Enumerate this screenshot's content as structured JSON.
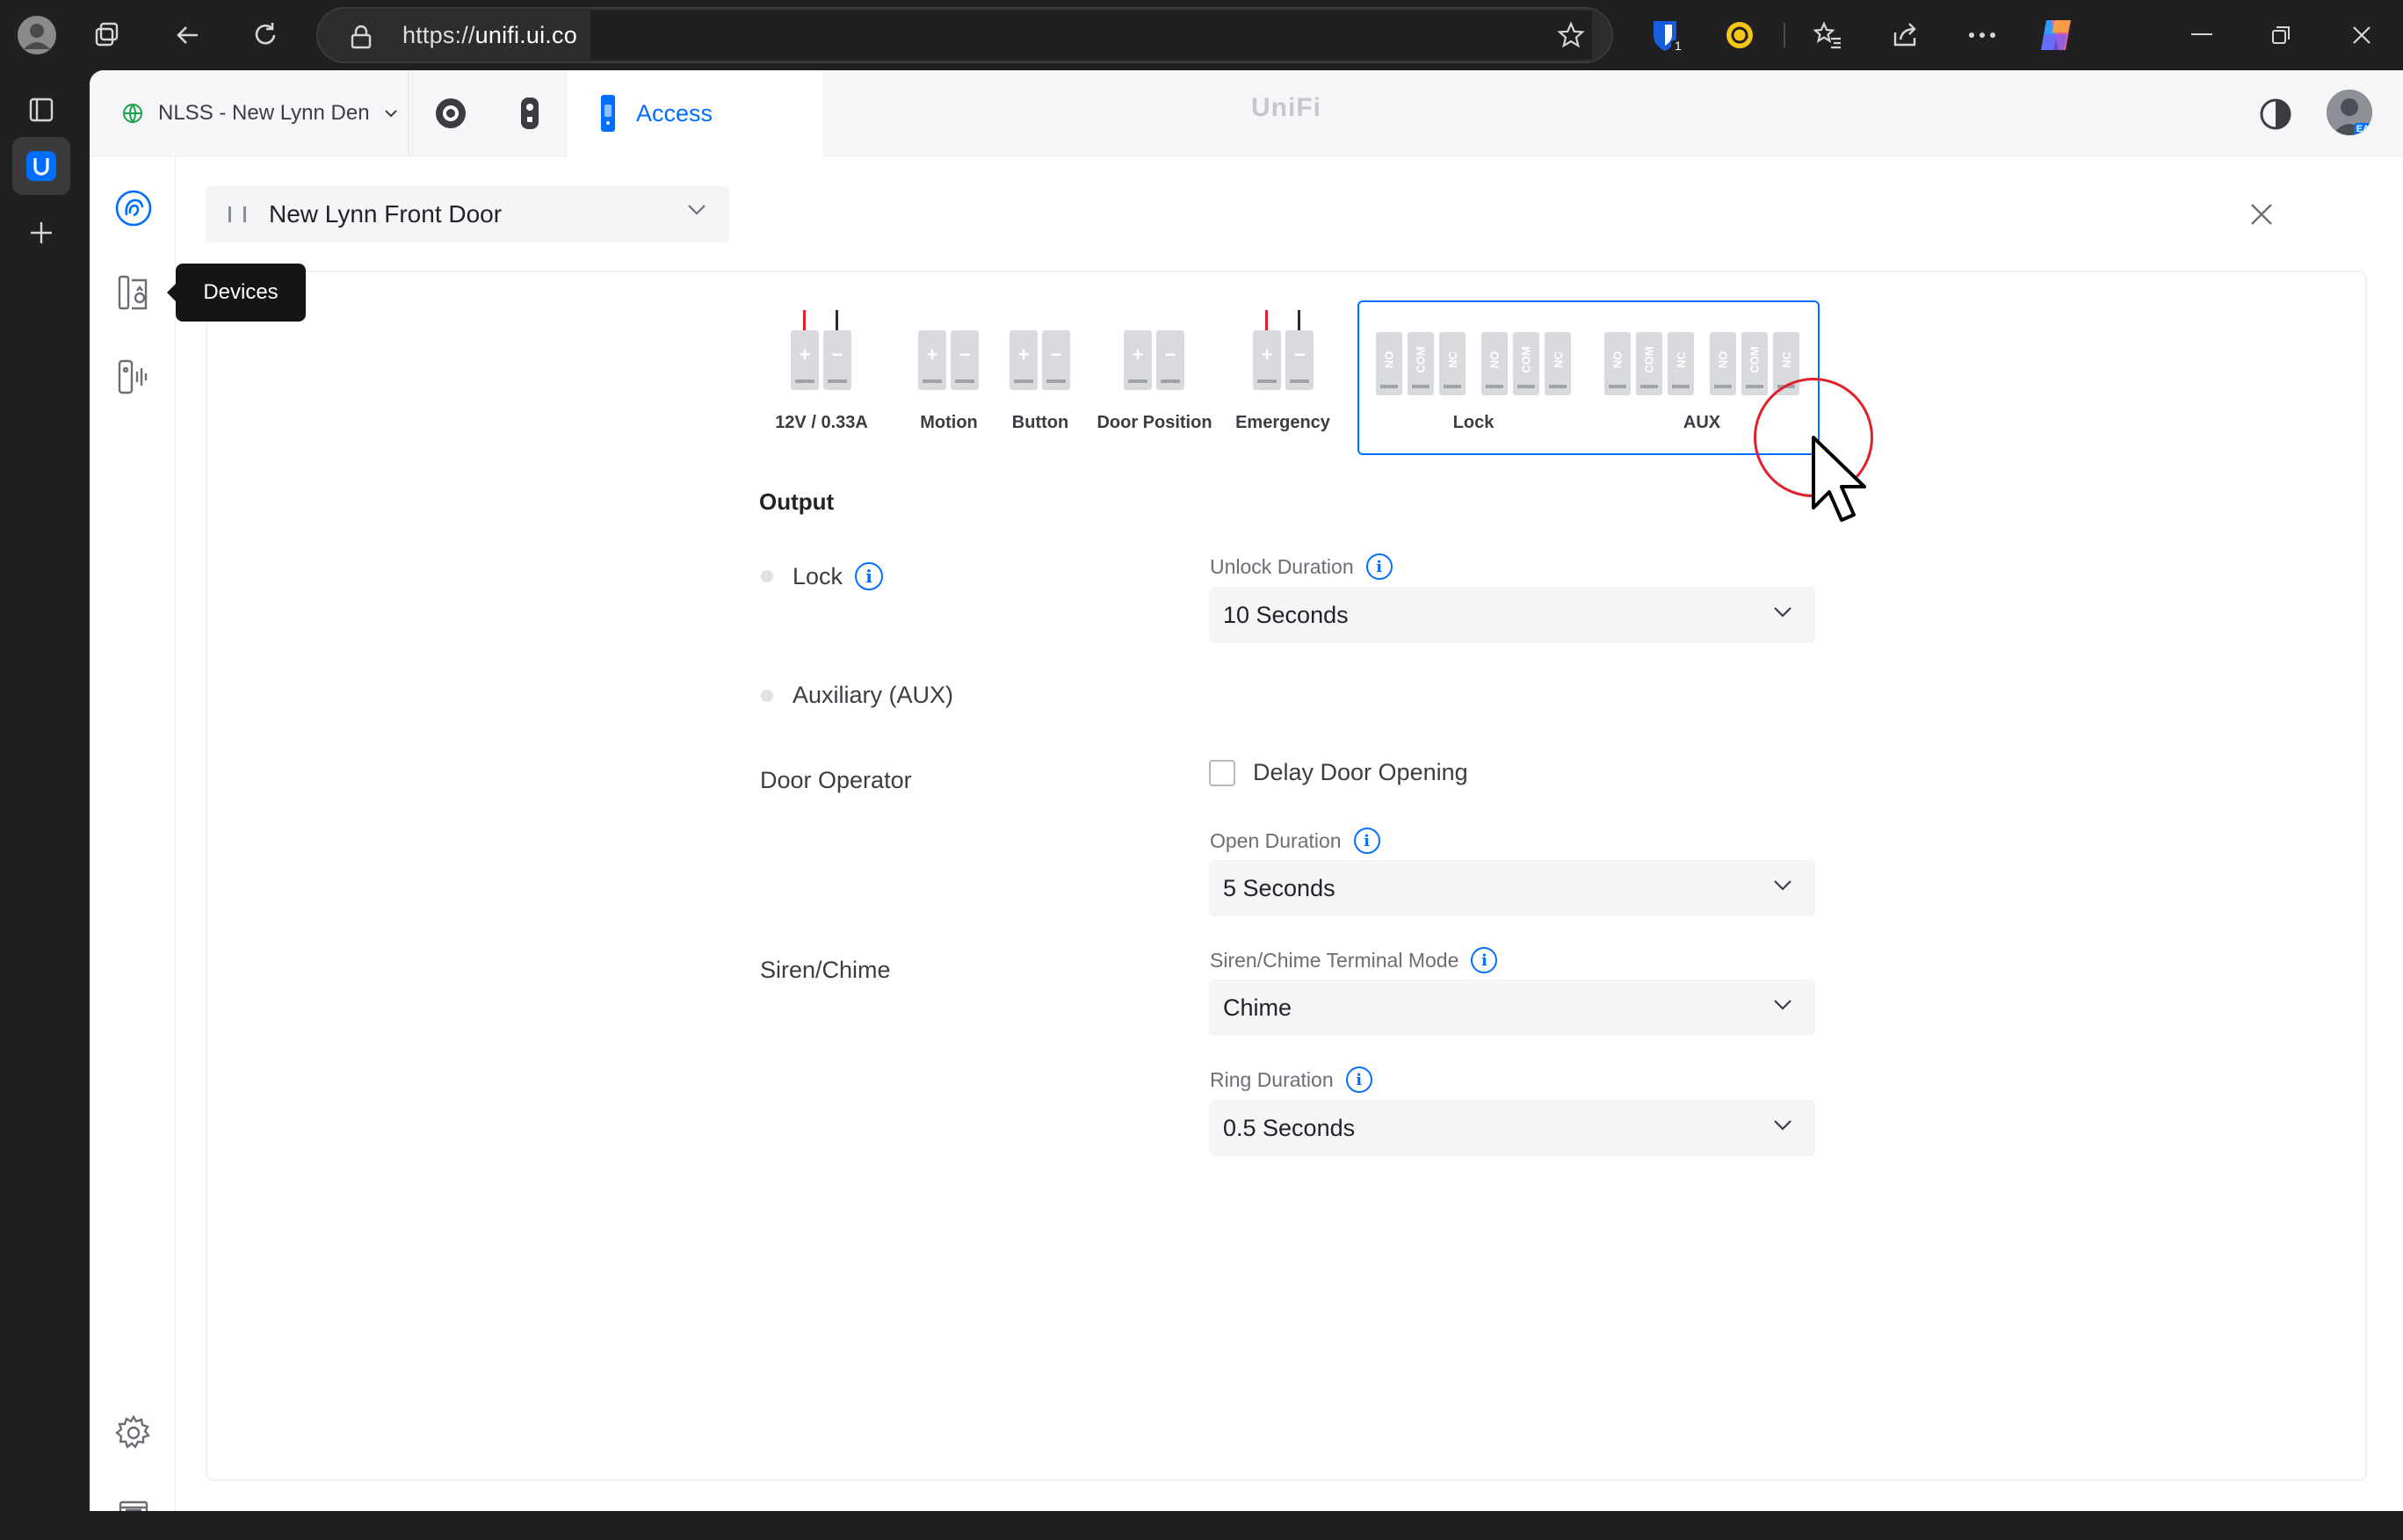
{
  "browser": {
    "url_prefix": "https://",
    "url_host": "unifi.ui.co",
    "extension_badge": "1"
  },
  "topbar": {
    "site_name": "NLSS - New Lynn Den",
    "active_app": "Access",
    "brand": "UniFi",
    "avatar_initials": "EA"
  },
  "nav": {
    "tooltip": "Devices"
  },
  "door": {
    "selected": "New Lynn Front Door"
  },
  "terminals": {
    "power": {
      "label": "12V / 0.33A",
      "pins": [
        "+",
        "−"
      ]
    },
    "motion": {
      "label": "Motion",
      "pins": [
        "+",
        "−"
      ]
    },
    "button": {
      "label": "Button",
      "pins": [
        "+",
        "−"
      ]
    },
    "door_position": {
      "label": "Door Position",
      "pins": [
        "+",
        "−"
      ]
    },
    "emergency": {
      "label": "Emergency",
      "pins": [
        "+",
        "−"
      ]
    },
    "lock": {
      "label": "Lock",
      "pins": [
        "NO",
        "COM",
        "NC",
        "NO",
        "COM",
        "NC"
      ]
    },
    "aux": {
      "label": "AUX",
      "pins": [
        "NO",
        "COM",
        "NC",
        "NO",
        "COM",
        "NC"
      ]
    }
  },
  "output": {
    "title": "Output",
    "lock_label": "Lock",
    "aux_label": "Auxiliary (AUX)",
    "unlock_duration_label": "Unlock Duration",
    "unlock_duration_value": "10 Seconds",
    "door_operator_label": "Door Operator",
    "delay_door_opening_label": "Delay Door Opening",
    "delay_door_opening_checked": false,
    "open_duration_label": "Open Duration",
    "open_duration_value": "5 Seconds",
    "siren_label": "Siren/Chime",
    "siren_mode_label": "Siren/Chime Terminal Mode",
    "siren_mode_value": "Chime",
    "ring_duration_label": "Ring Duration",
    "ring_duration_value": "0.5 Seconds"
  },
  "colors": {
    "accent": "#006fff",
    "chrome": "#202020",
    "cursor_ring": "#e0212b"
  }
}
